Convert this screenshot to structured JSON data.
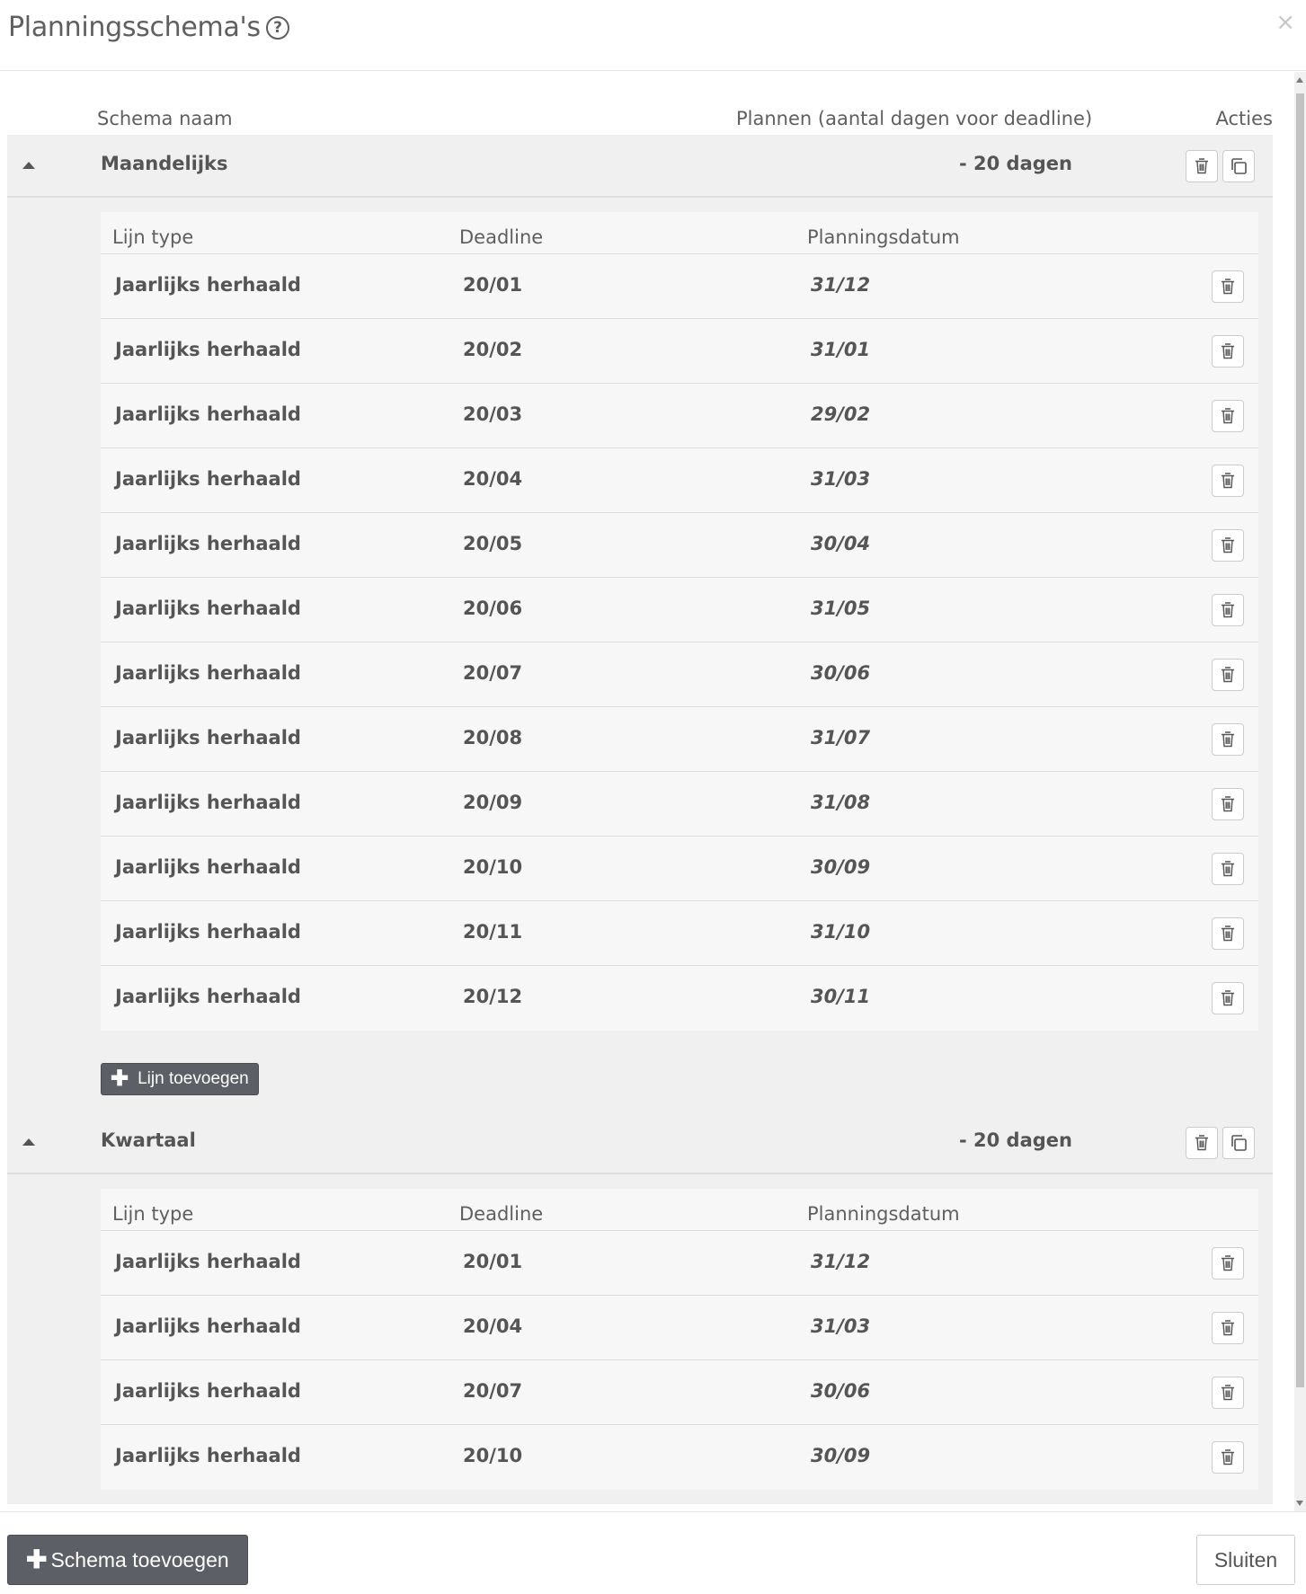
{
  "modal": {
    "title": "Planningsschema's",
    "help_icon": "question-circle-icon",
    "close_icon": "close-icon",
    "close_glyph": "×"
  },
  "columns": {
    "name": "Schema naam",
    "plan": "Plannen (aantal dagen voor deadline)",
    "actions": "Acties"
  },
  "line_columns": {
    "type": "Lijn type",
    "deadline": "Deadline",
    "planning_date": "Planningsdatum"
  },
  "schemas": [
    {
      "name": "Maandelijks",
      "days": "- 20 dagen",
      "add_line_label": "Lijn toevoegen",
      "lines": [
        {
          "type": "Jaarlijks herhaald",
          "deadline": "20/01",
          "planning": "31/12"
        },
        {
          "type": "Jaarlijks herhaald",
          "deadline": "20/02",
          "planning": "31/01"
        },
        {
          "type": "Jaarlijks herhaald",
          "deadline": "20/03",
          "planning": "29/02"
        },
        {
          "type": "Jaarlijks herhaald",
          "deadline": "20/04",
          "planning": "31/03"
        },
        {
          "type": "Jaarlijks herhaald",
          "deadline": "20/05",
          "planning": "30/04"
        },
        {
          "type": "Jaarlijks herhaald",
          "deadline": "20/06",
          "planning": "31/05"
        },
        {
          "type": "Jaarlijks herhaald",
          "deadline": "20/07",
          "planning": "30/06"
        },
        {
          "type": "Jaarlijks herhaald",
          "deadline": "20/08",
          "planning": "31/07"
        },
        {
          "type": "Jaarlijks herhaald",
          "deadline": "20/09",
          "planning": "31/08"
        },
        {
          "type": "Jaarlijks herhaald",
          "deadline": "20/10",
          "planning": "30/09"
        },
        {
          "type": "Jaarlijks herhaald",
          "deadline": "20/11",
          "planning": "31/10"
        },
        {
          "type": "Jaarlijks herhaald",
          "deadline": "20/12",
          "planning": "30/11"
        }
      ]
    },
    {
      "name": "Kwartaal",
      "days": "- 20 dagen",
      "lines": [
        {
          "type": "Jaarlijks herhaald",
          "deadline": "20/01",
          "planning": "31/12"
        },
        {
          "type": "Jaarlijks herhaald",
          "deadline": "20/04",
          "planning": "31/03"
        },
        {
          "type": "Jaarlijks herhaald",
          "deadline": "20/07",
          "planning": "30/06"
        },
        {
          "type": "Jaarlijks herhaald",
          "deadline": "20/10",
          "planning": "30/09"
        }
      ]
    }
  ],
  "footer": {
    "add_schema_label": "Schema toevoegen",
    "close_label": "Sluiten"
  },
  "icons": {
    "delete": "trash-icon",
    "copy": "copy-icon",
    "collapse": "caret-up-icon",
    "add": "plus-icon"
  },
  "colors": {
    "primary_button": "#5d5f66",
    "group_background": "#f0f0f0",
    "line_background": "#f7f7f7",
    "text": "#555555"
  }
}
